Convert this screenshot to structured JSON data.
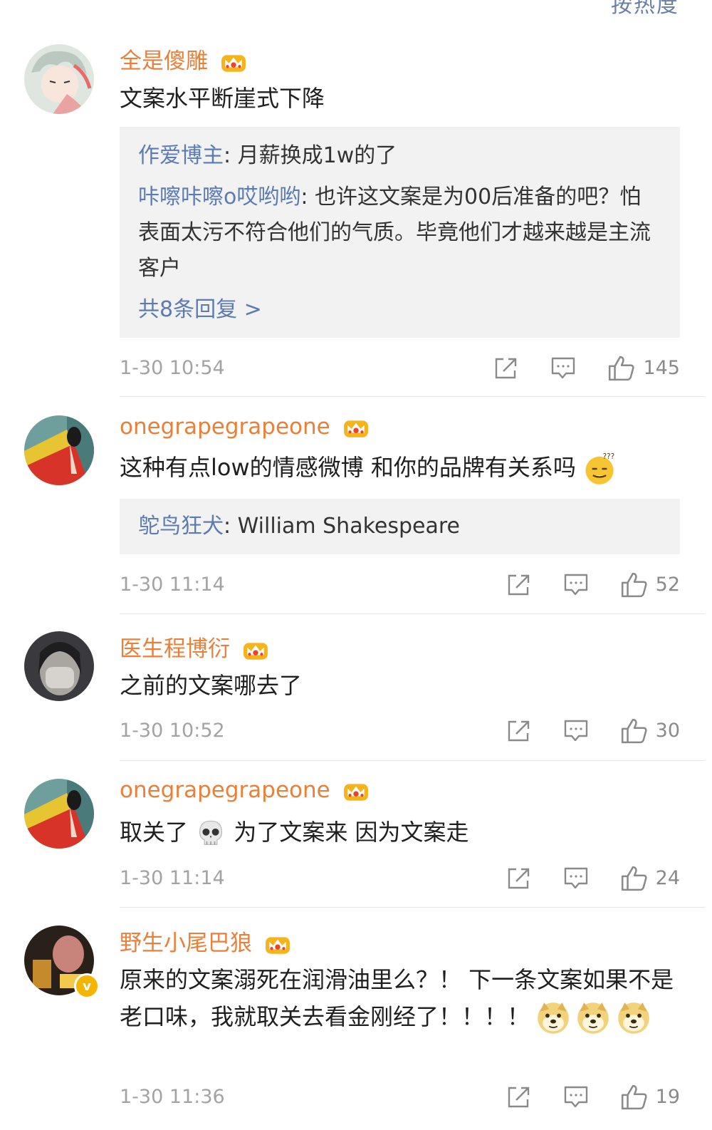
{
  "header": {
    "sort_label": "按热度"
  },
  "comments": [
    {
      "user": "全是傻雕",
      "text": "文案水平断崖式下降",
      "replies": [
        {
          "name": "作爱博主",
          "sep": ": ",
          "text": "月薪换成1w的了"
        },
        {
          "name": "咔嚓咔嚓o哎哟哟",
          "sep": ": ",
          "text": "也许这文案是为00后准备的吧？怕表面太污不符合他们的气质。毕竟他们才越来越是主流客户"
        }
      ],
      "more": "共8条回复 >",
      "time": "1-30 10:54",
      "likes": "145"
    },
    {
      "user": "onegrapegrapeone",
      "text": "这种有点low的情感微博  和你的品牌有关系吗",
      "replies": [
        {
          "name": "鸵鸟狂犬",
          "sep": ": ",
          "text": "William Shakespeare"
        }
      ],
      "time": "1-30 11:14",
      "likes": "52"
    },
    {
      "user": "医生程博衍",
      "text": "之前的文案哪去了",
      "time": "1-30 10:52",
      "likes": "30"
    },
    {
      "user": "onegrapegrapeone",
      "text_a": "取关了",
      "text_b": " 为了文案来  因为文案走",
      "time": "1-30 11:14",
      "likes": "24"
    },
    {
      "user": "野生小尾巴狼",
      "text": "原来的文案溺死在润滑油里么？！ 下一条文案如果不是老口味，我就取关去看金刚经了！！！！",
      "time": "1-30 11:36",
      "likes": "19"
    }
  ],
  "icons": {
    "share": "share-icon",
    "comment": "comment-icon",
    "like": "like-icon",
    "crown": "vip-crown-icon"
  },
  "colors": {
    "username": "#e9803a",
    "reply_name": "#5b7bb5",
    "meta": "#a3a3a3"
  }
}
